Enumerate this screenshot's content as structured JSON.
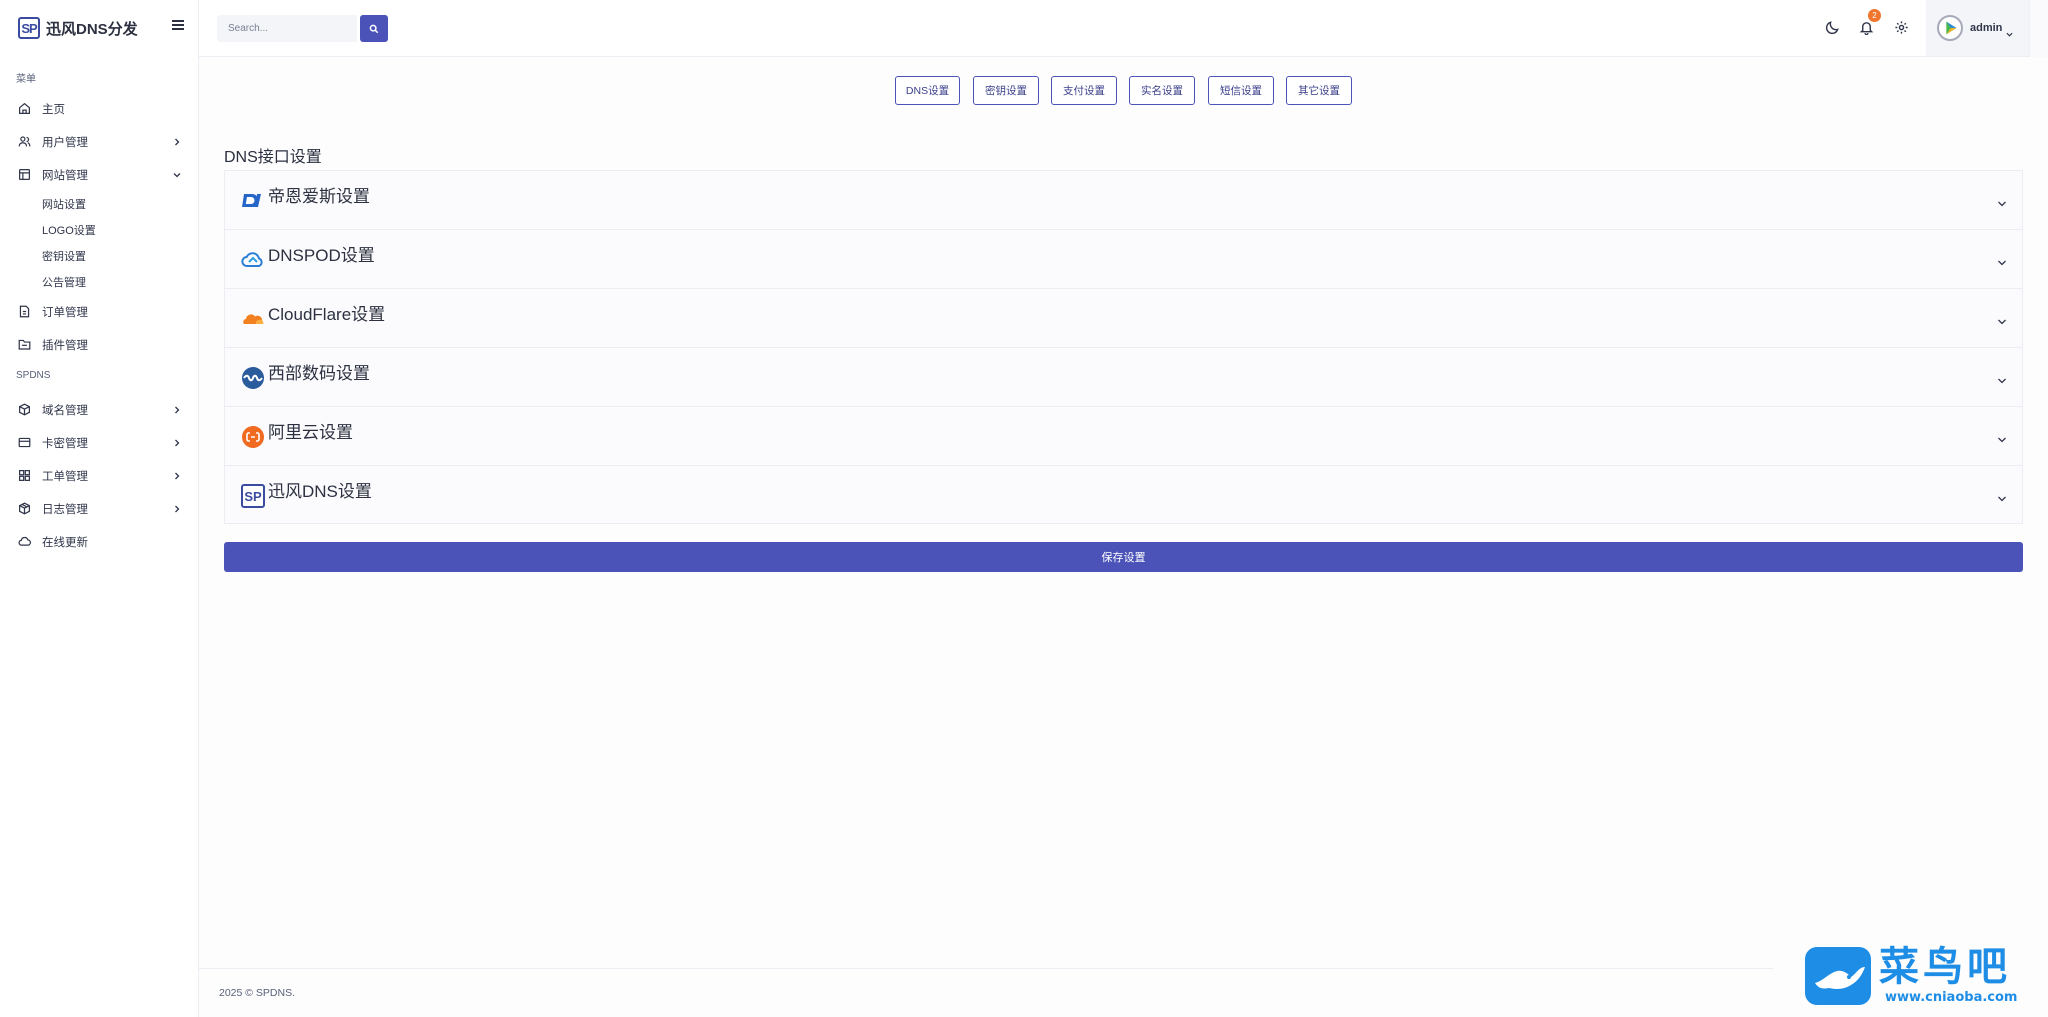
{
  "brand": {
    "logo_text": "SP",
    "name": "迅风DNS分发"
  },
  "sidebar": {
    "section1_label": "菜单",
    "home": "主页",
    "users": "用户管理",
    "site": "网站管理",
    "site_sub": [
      "网站设置",
      "LOGO设置",
      "密钥设置",
      "公告管理"
    ],
    "orders": "订单管理",
    "plugins": "插件管理",
    "section2_label": "SPDNS",
    "domains": "域名管理",
    "cards": "卡密管理",
    "tickets": "工单管理",
    "logs": "日志管理",
    "update": "在线更新"
  },
  "topbar": {
    "search_placeholder": "Search...",
    "notification_count": "2",
    "username": "admin"
  },
  "tabs": [
    "DNS设置",
    "密钥设置",
    "支付设置",
    "实名设置",
    "短信设置",
    "其它设置"
  ],
  "main": {
    "section_title": "DNS接口设置",
    "providers": [
      {
        "title": "帝恩爱斯设置",
        "icon": "dns-la-logo"
      },
      {
        "title": "DNSPOD设置",
        "icon": "dnspod-cloud-logo"
      },
      {
        "title": "CloudFlare设置",
        "icon": "cloudflare-logo"
      },
      {
        "title": "西部数码设置",
        "icon": "west-cn-logo"
      },
      {
        "title": "阿里云设置",
        "icon": "aliyun-logo"
      },
      {
        "title": "迅风DNS设置",
        "icon": "spdns-logo"
      }
    ],
    "save_label": "保存设置"
  },
  "footer": {
    "text": "2025 © SPDNS."
  },
  "watermark": {
    "cn": "菜鸟吧",
    "url": "www.cniaoba.com"
  },
  "colors": {
    "accent": "#4b53b8",
    "badge": "#f0762d",
    "watermark": "#1e8de6"
  }
}
